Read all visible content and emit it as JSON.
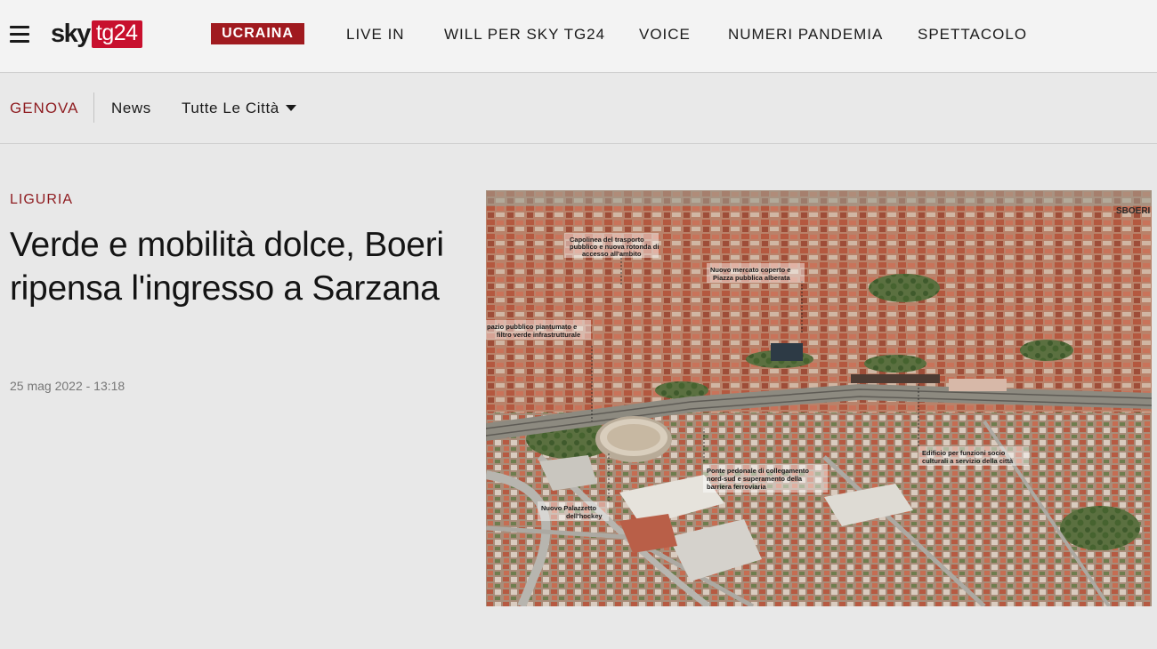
{
  "header": {
    "logo": {
      "sky": "sky",
      "tg": "tg24"
    },
    "menu_icon": "hamburger-menu-icon",
    "badge": "UCRAINA",
    "nav": [
      "LIVE IN",
      "WILL PER SKY TG24",
      "VOICE",
      "NUMERI PANDEMIA",
      "SPETTACOLO"
    ]
  },
  "subnav": {
    "city": "GENOVA",
    "news": "News",
    "cities_dropdown": "Tutte Le Città"
  },
  "article": {
    "kicker": "LIGURIA",
    "headline": "Verde e mobilità dolce, Boeri ripensa l'ingresso a Sarzana",
    "date": "25 mag 2022 - 13:18"
  },
  "image": {
    "annotations": [
      [
        "Capolinea del trasporto",
        "pubblico e nuova rotonda di",
        "accesso all'ambito"
      ],
      [
        "Nuovo mercato coperto e",
        "Piazza pubblica alberata"
      ],
      [
        "pazio pubblico piantumato e",
        "filtro verde infrastrutturale"
      ],
      [
        "Ponte pedonale di collegamento",
        "nord-sud e superamento della",
        "barriera ferroviaria"
      ],
      [
        "Edificio per funzioni socio",
        "culturali a servizio della città"
      ],
      [
        "Nuovo Palazzetto",
        "dell'hockey"
      ]
    ]
  },
  "colors": {
    "accent": "#a01a1f",
    "kicker": "#8e1b1f",
    "logo_red": "#c8102e"
  }
}
